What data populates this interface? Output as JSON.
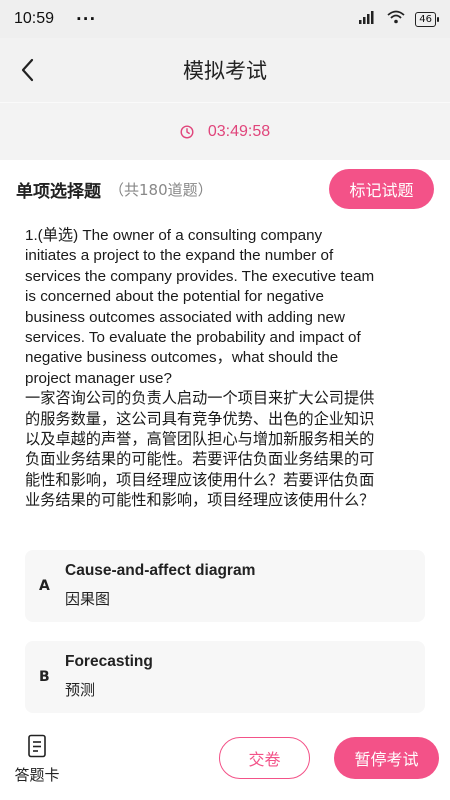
{
  "status_bar": {
    "time": "10:59",
    "dots": "···",
    "battery": "46"
  },
  "header": {
    "title": "模拟考试",
    "back_icon": "chevron-left-icon"
  },
  "timer": {
    "icon": "clock-icon",
    "value": "03:49:58"
  },
  "section": {
    "title": "单项选择题",
    "count": "（共180道题）",
    "mark_label": "标记试题"
  },
  "question": {
    "lines": [
      "1.(单选) The owner of a consulting company",
      "initiates a project to the expand the number of",
      "services the company provides. The executive team",
      "is concerned about the potential for negative",
      "business outcomes associated with adding new",
      "services. To evaluate the probability and impact of",
      "negative business outcomes，what should the",
      "project manager use?",
      "一家咨询公司的负责人启动一个项目来扩大公司提供",
      "的服务数量，这公司具有竞争优势、出色的企业知识",
      "以及卓越的声誉，高管团队担心与增加新服务相关的",
      "负面业务结果的可能性。若要评估负面业务结果的可",
      "能性和影响，项目经理应该使用什么？若要评估负面",
      "业务结果的可能性和影响，项目经理应该使用什么？"
    ]
  },
  "options": [
    {
      "letter": "A",
      "en": "Cause-and-affect diagram",
      "zh": "因果图"
    },
    {
      "letter": "B",
      "en": "Forecasting",
      "zh": "预测"
    }
  ],
  "bottom": {
    "answer_card_label": "答题卡",
    "answer_card_icon": "document-icon",
    "submit_label": "交卷",
    "pause_label": "暂停考试"
  },
  "colors": {
    "accent": "#f35288",
    "timer_text": "#e0457b"
  }
}
